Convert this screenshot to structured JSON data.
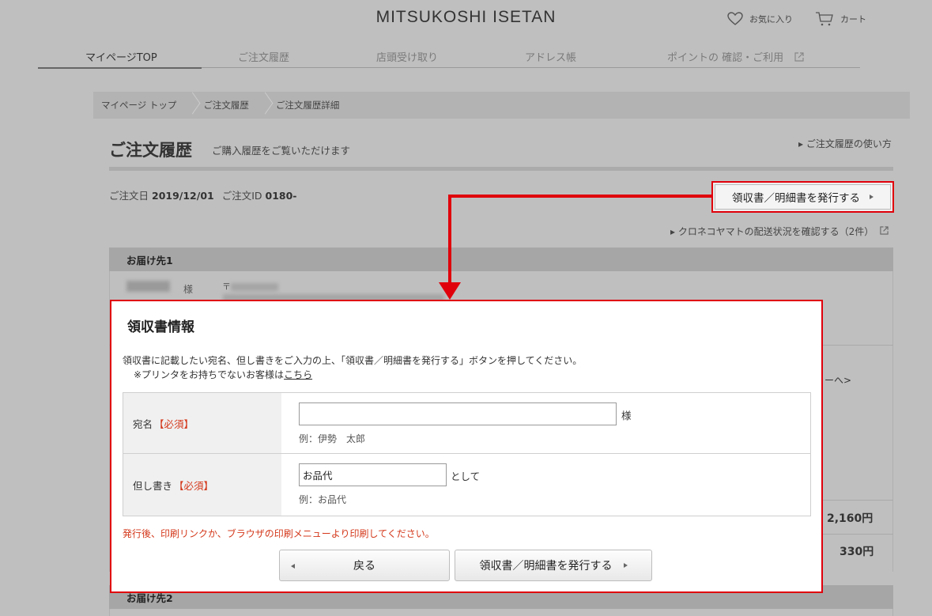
{
  "header": {
    "logo": "MITSUKOSHI ISETAN",
    "favorite_label": "お気に入り",
    "cart_label": "カート"
  },
  "nav": {
    "tabs": [
      "マイページTOP",
      "ご注文履歴",
      "店頭受け取り",
      "アドレス帳",
      "ポイントの 確認・ご利用"
    ]
  },
  "breadcrumb": [
    "マイページ トップ",
    "ご注文履歴",
    "ご注文履歴詳細"
  ],
  "page": {
    "title": "ご注文履歴",
    "subtitle": "ご購入履歴をご覧いただけます",
    "howto_link": "▸ ご注文履歴の使い方",
    "order_date_label": "ご注文日",
    "order_date": "2019/12/01",
    "order_id_label": "ご注文ID",
    "order_id": "0180-",
    "receipt_button": "領収書／明細書を発行する",
    "yamato_link": "▸ クロネコヤマトの配送状況を確認する（2件）",
    "delivery1_header": "お届け先1",
    "delivery2_header": "お届け先2",
    "honorific": "様",
    "postal_mark": "〒",
    "fragment_link": "ーへ>",
    "amount1": "2,160円",
    "amount2": "330円"
  },
  "modal": {
    "title": "領収書情報",
    "desc_line1": "領収書に記載したい宛名、但し書きをご入力の上、「領収書／明細書を発行する」ボタンを押してください。",
    "desc_line2_prefix": "※プリンタをお持ちでないお客様は",
    "desc_line2_link": "こちら",
    "addressee_label": "宛名",
    "required_tag": "【必須】",
    "addressee_value": "",
    "addressee_suffix": "様",
    "addressee_example": "例：伊勢　太郎",
    "proviso_label": "但し書き",
    "proviso_value": "お品代",
    "proviso_suffix": "として",
    "proviso_example": "例：お品代",
    "print_note": "発行後、印刷リンクか、ブラウザの印刷メニューより印刷してください。",
    "back_button": "戻る",
    "issue_button": "領収書／明細書を発行する"
  },
  "colors": {
    "highlight_red": "#e0000b",
    "required_orange": "#d4391c",
    "overlay_gray": "#bfbfbf"
  }
}
